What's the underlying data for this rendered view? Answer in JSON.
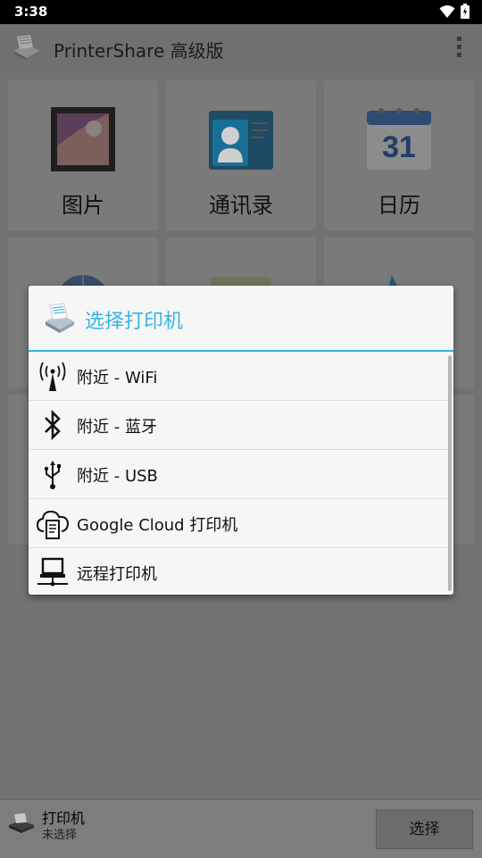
{
  "status_bar": {
    "time": "3:38"
  },
  "app_bar": {
    "title": "PrinterShare 高级版"
  },
  "tiles": [
    {
      "label": "图片"
    },
    {
      "label": "通讯录"
    },
    {
      "label": "日历"
    }
  ],
  "calendar_icon": {
    "day": "31"
  },
  "dialog": {
    "title": "选择打印机",
    "options": [
      {
        "label": "附近 - WiFi",
        "icon": "wifi-tower-icon"
      },
      {
        "label": "附近 - 蓝牙",
        "icon": "bluetooth-icon"
      },
      {
        "label": "附近 - USB",
        "icon": "usb-icon"
      },
      {
        "label": "Google Cloud 打印机",
        "icon": "cloud-print-icon"
      },
      {
        "label": "远程打印机",
        "icon": "remote-computer-icon"
      }
    ]
  },
  "bottom_bar": {
    "printer_title": "打印机",
    "printer_status": "未选择",
    "select_label": "选择"
  }
}
